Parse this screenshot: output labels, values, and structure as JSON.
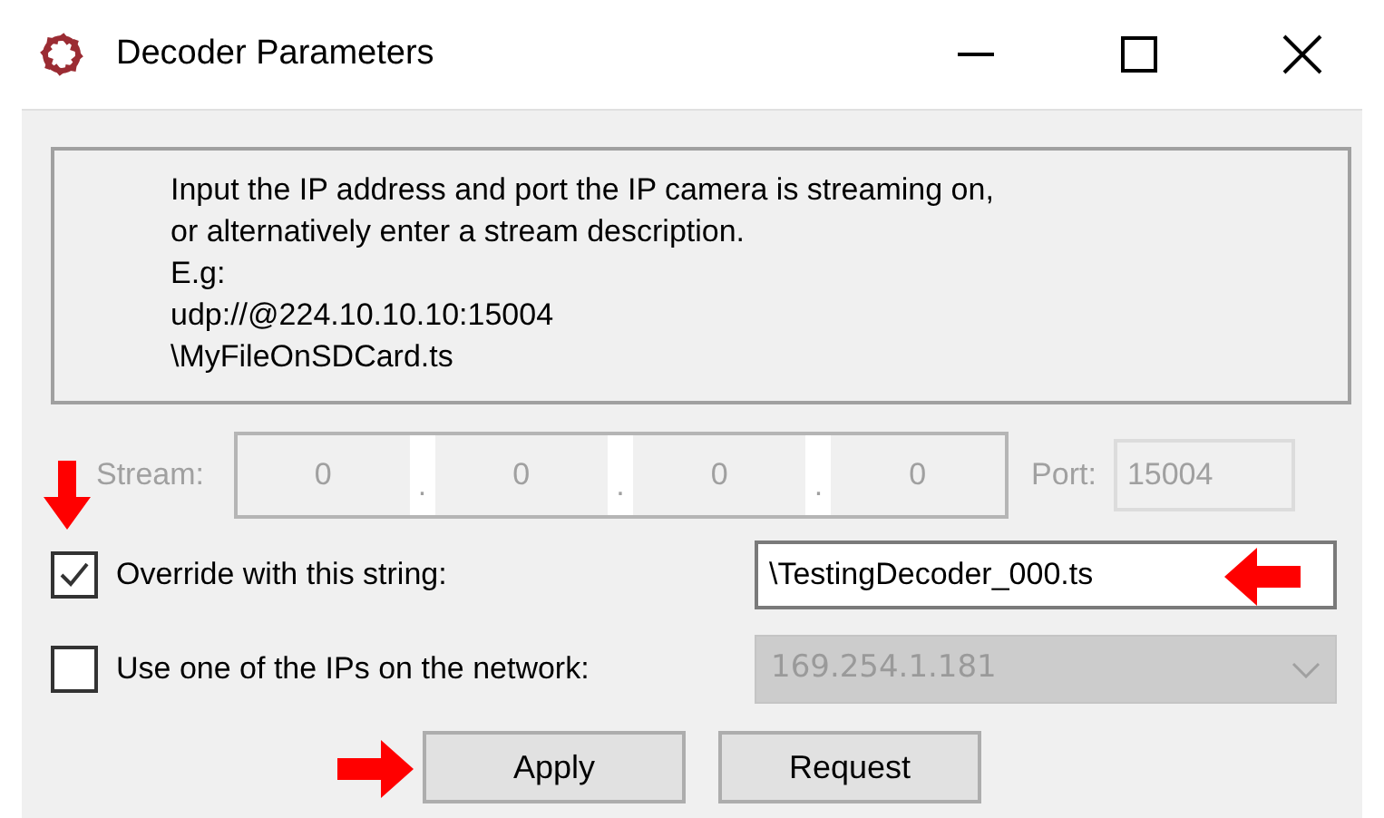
{
  "window": {
    "title": "Decoder Parameters"
  },
  "description": [
    "Input the IP address and port the IP camera is streaming on,",
    "or alternatively enter a stream description.",
    "E.g:",
    "udp://@224.10.10.10:15004",
    "\\MyFileOnSDCard.ts"
  ],
  "ip_stream": {
    "label": "Stream:",
    "disabled": true,
    "octets": [
      "0",
      "0",
      "0",
      "0"
    ],
    "separators": [
      ".",
      ".",
      "."
    ],
    "port_label": "Port:",
    "port": "15004"
  },
  "override": {
    "label": "Override with this string:",
    "checked": true,
    "value": "\\TestingDecoder_000.ts"
  },
  "network": {
    "label": "Use one of the IPs on the network:",
    "checked": false,
    "value": "169.254.1.181",
    "disabled": true
  },
  "buttons": [
    "Apply",
    "Request"
  ],
  "annotations": [
    {
      "kind": "down"
    },
    {
      "kind": "left"
    },
    {
      "kind": "right"
    }
  ]
}
